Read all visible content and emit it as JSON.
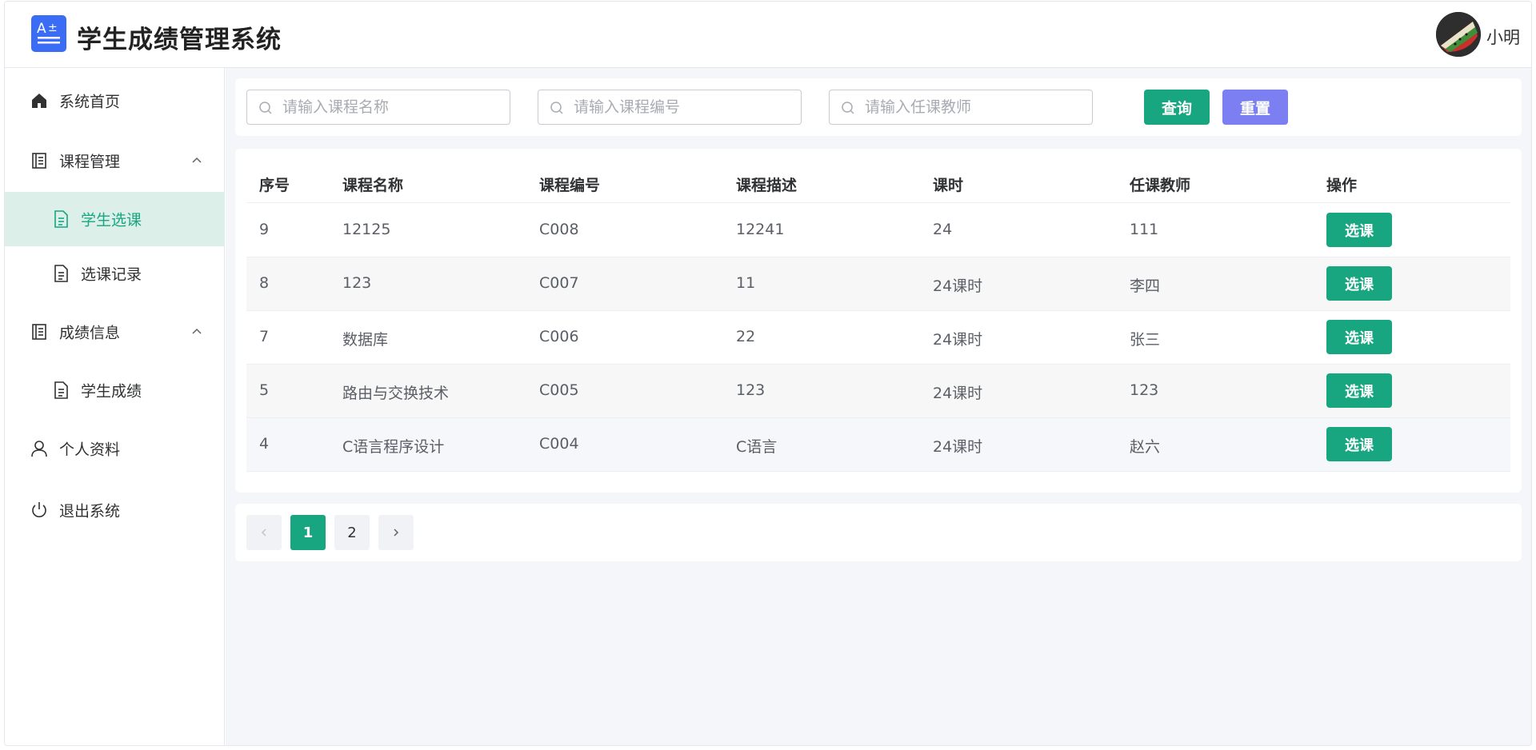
{
  "header": {
    "app_title": "学生成绩管理系统",
    "logo_text": "A±",
    "username": "小明"
  },
  "sidebar": {
    "items": [
      {
        "label": "系统首页",
        "icon": "home-icon"
      },
      {
        "label": "课程管理",
        "icon": "document-list-icon",
        "expanded": true,
        "children": [
          {
            "label": "学生选课",
            "icon": "file-icon",
            "active": true
          },
          {
            "label": "选课记录",
            "icon": "file-icon"
          }
        ]
      },
      {
        "label": "成绩信息",
        "icon": "document-list-icon",
        "expanded": true,
        "children": [
          {
            "label": "学生成绩",
            "icon": "file-icon"
          }
        ]
      },
      {
        "label": "个人资料",
        "icon": "user-icon"
      },
      {
        "label": "退出系统",
        "icon": "power-icon"
      }
    ]
  },
  "search": {
    "course_name_placeholder": "请输入课程名称",
    "course_code_placeholder": "请输入课程编号",
    "teacher_placeholder": "请输入任课教师",
    "query_label": "查询",
    "reset_label": "重置"
  },
  "table": {
    "columns": [
      "序号",
      "课程名称",
      "课程编号",
      "课程描述",
      "课时",
      "任课教师",
      "操作"
    ],
    "rows": [
      {
        "id": "9",
        "name": "12125",
        "code": "C008",
        "desc": "12241",
        "hours": "24",
        "teacher": "111",
        "action": "选课"
      },
      {
        "id": "8",
        "name": "123",
        "code": "C007",
        "desc": "11",
        "hours": "24课时",
        "teacher": "李四",
        "action": "选课"
      },
      {
        "id": "7",
        "name": "数据库",
        "code": "C006",
        "desc": "22",
        "hours": "24课时",
        "teacher": "张三",
        "action": "选课"
      },
      {
        "id": "5",
        "name": "路由与交换技术",
        "code": "C005",
        "desc": "123",
        "hours": "24课时",
        "teacher": "123",
        "action": "选课"
      },
      {
        "id": "4",
        "name": "C语言程序设计",
        "code": "C004",
        "desc": "C语言",
        "hours": "24课时",
        "teacher": "赵六",
        "action": "选课"
      }
    ]
  },
  "pagination": {
    "pages": [
      "1",
      "2"
    ],
    "current_page": "1"
  },
  "colors": {
    "primary": "#17a680",
    "reset_button": "#7b7ff2",
    "logo_bg": "#3b6cf5",
    "active_menu_bg": "#dcefe9"
  }
}
